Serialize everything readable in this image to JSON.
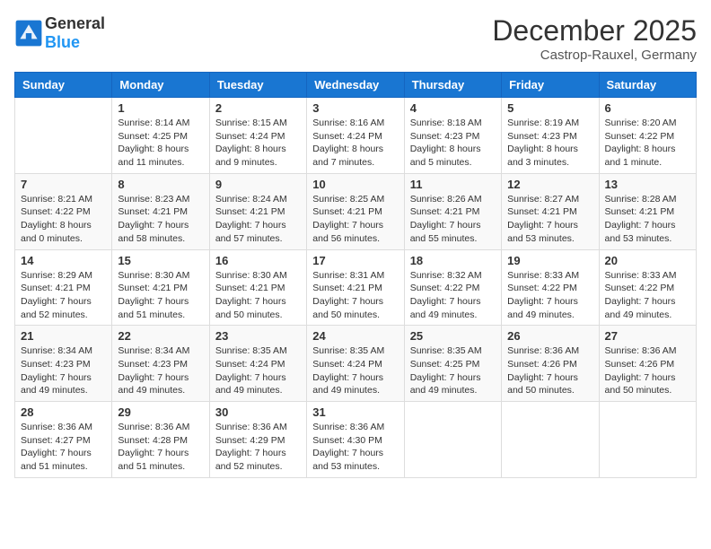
{
  "header": {
    "logo_general": "General",
    "logo_blue": "Blue",
    "month_title": "December 2025",
    "location": "Castrop-Rauxel, Germany"
  },
  "days_of_week": [
    "Sunday",
    "Monday",
    "Tuesday",
    "Wednesday",
    "Thursday",
    "Friday",
    "Saturday"
  ],
  "weeks": [
    [
      {
        "day": "",
        "info": ""
      },
      {
        "day": "1",
        "info": "Sunrise: 8:14 AM\nSunset: 4:25 PM\nDaylight: 8 hours\nand 11 minutes."
      },
      {
        "day": "2",
        "info": "Sunrise: 8:15 AM\nSunset: 4:24 PM\nDaylight: 8 hours\nand 9 minutes."
      },
      {
        "day": "3",
        "info": "Sunrise: 8:16 AM\nSunset: 4:24 PM\nDaylight: 8 hours\nand 7 minutes."
      },
      {
        "day": "4",
        "info": "Sunrise: 8:18 AM\nSunset: 4:23 PM\nDaylight: 8 hours\nand 5 minutes."
      },
      {
        "day": "5",
        "info": "Sunrise: 8:19 AM\nSunset: 4:23 PM\nDaylight: 8 hours\nand 3 minutes."
      },
      {
        "day": "6",
        "info": "Sunrise: 8:20 AM\nSunset: 4:22 PM\nDaylight: 8 hours\nand 1 minute."
      }
    ],
    [
      {
        "day": "7",
        "info": "Sunrise: 8:21 AM\nSunset: 4:22 PM\nDaylight: 8 hours\nand 0 minutes."
      },
      {
        "day": "8",
        "info": "Sunrise: 8:23 AM\nSunset: 4:21 PM\nDaylight: 7 hours\nand 58 minutes."
      },
      {
        "day": "9",
        "info": "Sunrise: 8:24 AM\nSunset: 4:21 PM\nDaylight: 7 hours\nand 57 minutes."
      },
      {
        "day": "10",
        "info": "Sunrise: 8:25 AM\nSunset: 4:21 PM\nDaylight: 7 hours\nand 56 minutes."
      },
      {
        "day": "11",
        "info": "Sunrise: 8:26 AM\nSunset: 4:21 PM\nDaylight: 7 hours\nand 55 minutes."
      },
      {
        "day": "12",
        "info": "Sunrise: 8:27 AM\nSunset: 4:21 PM\nDaylight: 7 hours\nand 53 minutes."
      },
      {
        "day": "13",
        "info": "Sunrise: 8:28 AM\nSunset: 4:21 PM\nDaylight: 7 hours\nand 53 minutes."
      }
    ],
    [
      {
        "day": "14",
        "info": "Sunrise: 8:29 AM\nSunset: 4:21 PM\nDaylight: 7 hours\nand 52 minutes."
      },
      {
        "day": "15",
        "info": "Sunrise: 8:30 AM\nSunset: 4:21 PM\nDaylight: 7 hours\nand 51 minutes."
      },
      {
        "day": "16",
        "info": "Sunrise: 8:30 AM\nSunset: 4:21 PM\nDaylight: 7 hours\nand 50 minutes."
      },
      {
        "day": "17",
        "info": "Sunrise: 8:31 AM\nSunset: 4:21 PM\nDaylight: 7 hours\nand 50 minutes."
      },
      {
        "day": "18",
        "info": "Sunrise: 8:32 AM\nSunset: 4:22 PM\nDaylight: 7 hours\nand 49 minutes."
      },
      {
        "day": "19",
        "info": "Sunrise: 8:33 AM\nSunset: 4:22 PM\nDaylight: 7 hours\nand 49 minutes."
      },
      {
        "day": "20",
        "info": "Sunrise: 8:33 AM\nSunset: 4:22 PM\nDaylight: 7 hours\nand 49 minutes."
      }
    ],
    [
      {
        "day": "21",
        "info": "Sunrise: 8:34 AM\nSunset: 4:23 PM\nDaylight: 7 hours\nand 49 minutes."
      },
      {
        "day": "22",
        "info": "Sunrise: 8:34 AM\nSunset: 4:23 PM\nDaylight: 7 hours\nand 49 minutes."
      },
      {
        "day": "23",
        "info": "Sunrise: 8:35 AM\nSunset: 4:24 PM\nDaylight: 7 hours\nand 49 minutes."
      },
      {
        "day": "24",
        "info": "Sunrise: 8:35 AM\nSunset: 4:24 PM\nDaylight: 7 hours\nand 49 minutes."
      },
      {
        "day": "25",
        "info": "Sunrise: 8:35 AM\nSunset: 4:25 PM\nDaylight: 7 hours\nand 49 minutes."
      },
      {
        "day": "26",
        "info": "Sunrise: 8:36 AM\nSunset: 4:26 PM\nDaylight: 7 hours\nand 50 minutes."
      },
      {
        "day": "27",
        "info": "Sunrise: 8:36 AM\nSunset: 4:26 PM\nDaylight: 7 hours\nand 50 minutes."
      }
    ],
    [
      {
        "day": "28",
        "info": "Sunrise: 8:36 AM\nSunset: 4:27 PM\nDaylight: 7 hours\nand 51 minutes."
      },
      {
        "day": "29",
        "info": "Sunrise: 8:36 AM\nSunset: 4:28 PM\nDaylight: 7 hours\nand 51 minutes."
      },
      {
        "day": "30",
        "info": "Sunrise: 8:36 AM\nSunset: 4:29 PM\nDaylight: 7 hours\nand 52 minutes."
      },
      {
        "day": "31",
        "info": "Sunrise: 8:36 AM\nSunset: 4:30 PM\nDaylight: 7 hours\nand 53 minutes."
      },
      {
        "day": "",
        "info": ""
      },
      {
        "day": "",
        "info": ""
      },
      {
        "day": "",
        "info": ""
      }
    ]
  ]
}
